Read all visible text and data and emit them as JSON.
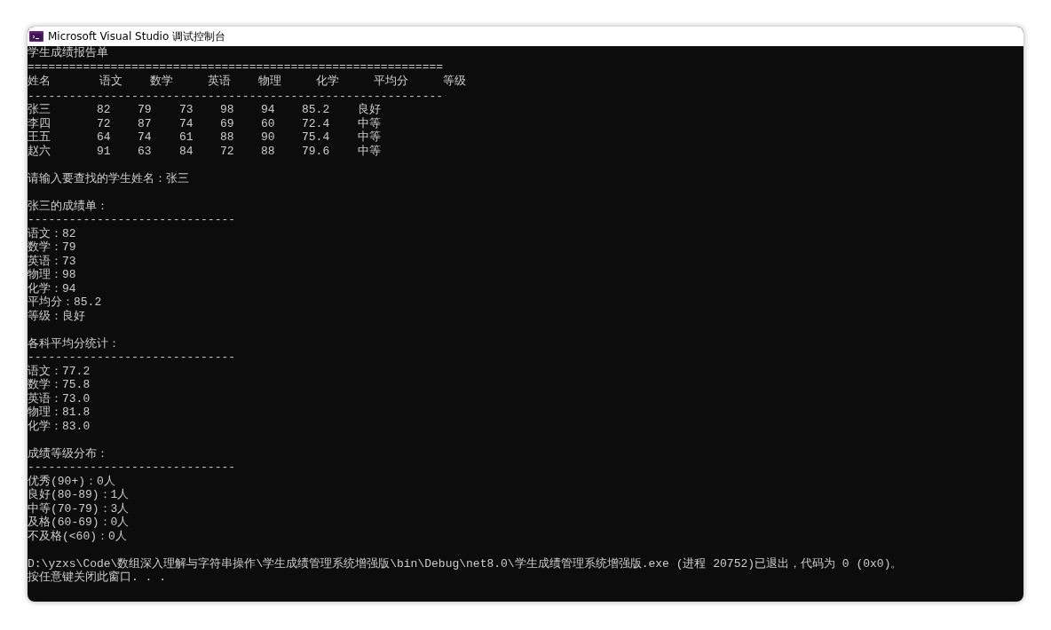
{
  "window": {
    "title": "Microsoft Visual Studio 调试控制台"
  },
  "report": {
    "title": "学生成绩报告单",
    "rule_top": "============================================================",
    "header_line": "姓名       语文    数学     英语    物理     化学     平均分     等级",
    "rule_bottom": "------------------------------------------------------------",
    "rows": [
      {
        "cells": [
          "张三",
          "82",
          "79",
          "73",
          "98",
          "94",
          "85.2",
          "良好"
        ]
      },
      {
        "cells": [
          "李四",
          "72",
          "87",
          "74",
          "69",
          "60",
          "72.4",
          "中等"
        ]
      },
      {
        "cells": [
          "王五",
          "64",
          "74",
          "61",
          "88",
          "90",
          "75.4",
          "中等"
        ]
      },
      {
        "cells": [
          "赵六",
          "91",
          "63",
          "84",
          "72",
          "88",
          "79.6",
          "中等"
        ]
      }
    ]
  },
  "prompt": "请输入要查找的学生姓名：张三",
  "sections": [
    {
      "heading": "张三的成绩单：",
      "rule": "------------------------------",
      "lines": [
        "语文：82",
        "数学：79",
        "英语：73",
        "物理：98",
        "化学：94",
        "平均分：85.2",
        "等级：良好"
      ]
    },
    {
      "heading": "各科平均分统计：",
      "rule": "------------------------------",
      "lines": [
        "语文：77.2",
        "数学：75.8",
        "英语：73.0",
        "物理：81.8",
        "化学：83.0"
      ]
    },
    {
      "heading": "成绩等级分布：",
      "rule": "------------------------------",
      "lines": [
        "优秀(90+)：0人",
        "良好(80-89)：1人",
        "中等(70-79)：3人",
        "及格(60-69)：0人",
        "不及格(<60)：0人"
      ]
    }
  ],
  "exit_lines": [
    "D:\\yzxs\\Code\\数组深入理解与字符串操作\\学生成绩管理系统增强版\\bin\\Debug\\net8.0\\学生成绩管理系统增强版.exe (进程 20752)已退出，代码为 0 (0x0)。",
    "按任意键关闭此窗口. . ."
  ]
}
